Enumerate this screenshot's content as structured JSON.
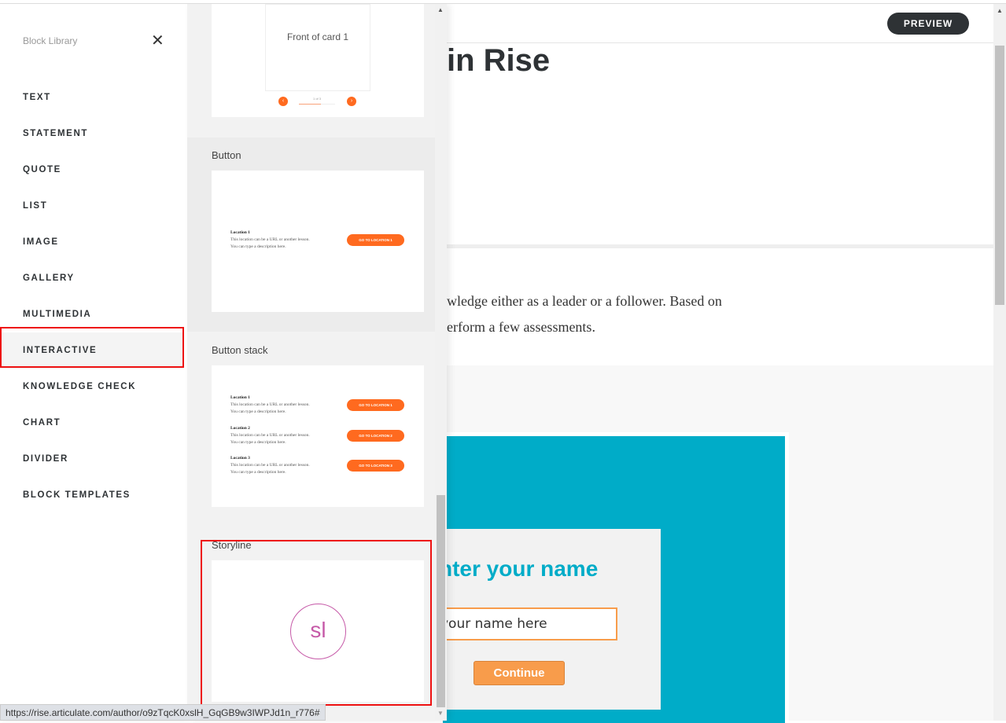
{
  "sidebar": {
    "title": "Block Library",
    "close_icon": "close-icon",
    "items": [
      "TEXT",
      "STATEMENT",
      "QUOTE",
      "LIST",
      "IMAGE",
      "GALLERY",
      "MULTIMEDIA",
      "INTERACTIVE",
      "KNOWLEDGE CHECK",
      "CHART",
      "DIVIDER",
      "BLOCK TEMPLATES"
    ],
    "selected": "INTERACTIVE"
  },
  "panel": {
    "flashcard": {
      "front": "Front of card 1",
      "counter": "1 of 3",
      "progress_fraction": 0.6
    },
    "button": {
      "label": "Button",
      "location": "Location 1",
      "desc1": "This location can be a URL or another lesson.",
      "desc2": "You can type a description here.",
      "cta": "GO TO LOCATION 1"
    },
    "button_stack": {
      "label": "Button stack",
      "items": [
        {
          "title": "Location 1",
          "cta": "GO TO LOCATION 1"
        },
        {
          "title": "Location 2",
          "cta": "GO TO LOCATION 2"
        },
        {
          "title": "Location 3",
          "cta": "GO TO LOCATION 3"
        }
      ],
      "desc1": "This location can be a URL or another lesson.",
      "desc2": "You can type a description here."
    },
    "storyline": {
      "label": "Storyline",
      "logo": "sl"
    }
  },
  "main": {
    "preview": "PREVIEW",
    "title": "in Rise",
    "para1": "wledge either as a leader or a follower. Based on",
    "para2": "erform a few assessments.",
    "embed": {
      "heading": "nter your name",
      "input_value": "your name here",
      "button": "Continue"
    }
  },
  "status_url": "https://rise.articulate.com/author/o9zTqcK0xslH_GqGB9w3IWPJd1n_r776#",
  "colors": {
    "accent": "#ff6a1f",
    "teal": "#00acc8",
    "highlight": "#ee1111"
  }
}
